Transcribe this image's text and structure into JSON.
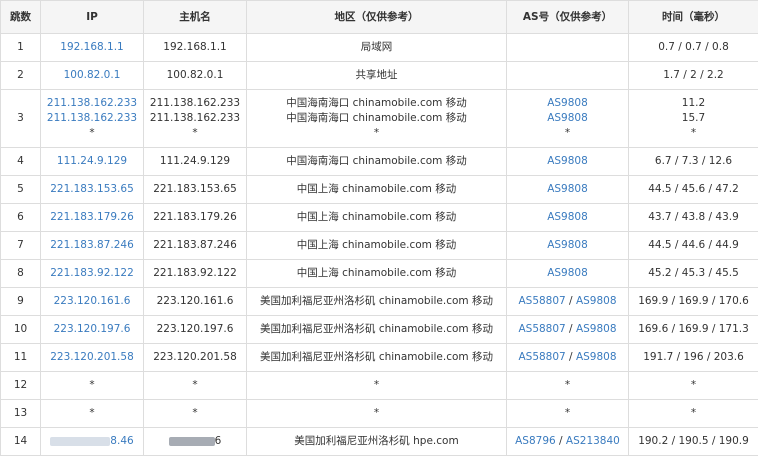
{
  "headers": [
    "跳数",
    "IP",
    "主机名",
    "地区（仅供参考）",
    "AS号（仅供参考）",
    "时间（毫秒）"
  ],
  "rows": [
    {
      "hop": "1",
      "ips": [
        "192.168.1.1"
      ],
      "hosts": [
        "192.168.1.1"
      ],
      "regions": [
        "局域网"
      ],
      "as": [],
      "times": [
        "0.7 / 0.7 / 0.8"
      ]
    },
    {
      "hop": "2",
      "ips": [
        "100.82.0.1"
      ],
      "hosts": [
        "100.82.0.1"
      ],
      "regions": [
        "共享地址"
      ],
      "as": [],
      "times": [
        "1.7 / 2 / 2.2"
      ]
    },
    {
      "hop": "3",
      "ips": [
        "211.138.162.233",
        "211.138.162.233",
        "*"
      ],
      "hosts": [
        "211.138.162.233",
        "211.138.162.233",
        "*"
      ],
      "regions": [
        "中国海南海口 chinamobile.com 移动",
        "中国海南海口 chinamobile.com 移动",
        "*"
      ],
      "as_lines": [
        [
          "AS9808"
        ],
        [
          "AS9808"
        ],
        [
          "*"
        ]
      ],
      "times": [
        "11.2",
        "15.7",
        "*"
      ]
    },
    {
      "hop": "4",
      "ips": [
        "111.24.9.129"
      ],
      "hosts": [
        "111.24.9.129"
      ],
      "regions": [
        "中国海南海口 chinamobile.com 移动"
      ],
      "as": [
        "AS9808"
      ],
      "times": [
        "6.7 / 7.3 / 12.6"
      ]
    },
    {
      "hop": "5",
      "ips": [
        "221.183.153.65"
      ],
      "hosts": [
        "221.183.153.65"
      ],
      "regions": [
        "中国上海 chinamobile.com 移动"
      ],
      "as": [
        "AS9808"
      ],
      "times": [
        "44.5 / 45.6 / 47.2"
      ]
    },
    {
      "hop": "6",
      "ips": [
        "221.183.179.26"
      ],
      "hosts": [
        "221.183.179.26"
      ],
      "regions": [
        "中国上海 chinamobile.com 移动"
      ],
      "as": [
        "AS9808"
      ],
      "times": [
        "43.7 / 43.8 / 43.9"
      ]
    },
    {
      "hop": "7",
      "ips": [
        "221.183.87.246"
      ],
      "hosts": [
        "221.183.87.246"
      ],
      "regions": [
        "中国上海 chinamobile.com 移动"
      ],
      "as": [
        "AS9808"
      ],
      "times": [
        "44.5 / 44.6 / 44.9"
      ]
    },
    {
      "hop": "8",
      "ips": [
        "221.183.92.122"
      ],
      "hosts": [
        "221.183.92.122"
      ],
      "regions": [
        "中国上海 chinamobile.com 移动"
      ],
      "as": [
        "AS9808"
      ],
      "times": [
        "45.2 / 45.3 / 45.5"
      ]
    },
    {
      "hop": "9",
      "ips": [
        "223.120.161.6"
      ],
      "hosts": [
        "223.120.161.6"
      ],
      "regions": [
        "美国加利福尼亚州洛杉矶 chinamobile.com 移动"
      ],
      "as": [
        "AS58807",
        "AS9808"
      ],
      "times": [
        "169.9 / 169.9 / 170.6"
      ]
    },
    {
      "hop": "10",
      "ips": [
        "223.120.197.6"
      ],
      "hosts": [
        "223.120.197.6"
      ],
      "regions": [
        "美国加利福尼亚州洛杉矶 chinamobile.com 移动"
      ],
      "as": [
        "AS58807",
        "AS9808"
      ],
      "times": [
        "169.6 / 169.9 / 171.3"
      ]
    },
    {
      "hop": "11",
      "ips": [
        "223.120.201.58"
      ],
      "hosts": [
        "223.120.201.58"
      ],
      "regions": [
        "美国加利福尼亚州洛杉矶 chinamobile.com 移动"
      ],
      "as": [
        "AS58807",
        "AS9808"
      ],
      "times": [
        "191.7 / 196 / 203.6"
      ]
    },
    {
      "hop": "12",
      "ips": [
        "*"
      ],
      "hosts": [
        "*"
      ],
      "regions": [
        "*"
      ],
      "as_lines": [
        [
          "*"
        ]
      ],
      "times": [
        "*"
      ]
    },
    {
      "hop": "13",
      "ips": [
        "*"
      ],
      "hosts": [
        "*"
      ],
      "regions": [
        "*"
      ],
      "as_lines": [
        [
          "*"
        ]
      ],
      "times": [
        "*"
      ]
    },
    {
      "hop": "14",
      "ip_redacted": true,
      "ip_visible_fragment": "8.46",
      "host_redacted": true,
      "host_visible_fragment": "6",
      "regions": [
        "美国加利福尼亚州洛杉矶 hpe.com"
      ],
      "as": [
        "AS8796",
        "AS213840"
      ],
      "times": [
        "190.2 / 190.5 / 190.9"
      ]
    }
  ],
  "colors": {
    "link": "#3a7bbf",
    "header_bg": "#f5f5f5",
    "border": "#dddddd",
    "text": "#333333"
  }
}
